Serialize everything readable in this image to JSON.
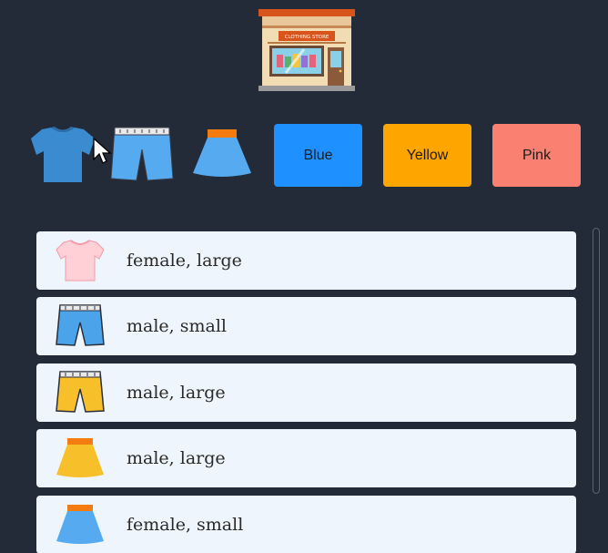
{
  "header": {
    "icon": "clothing-store-icon",
    "sign_text": "CLOTHING STORE"
  },
  "clothing_buttons": [
    {
      "icon": "tshirt-icon",
      "color": "#3b8bd0"
    },
    {
      "icon": "shorts-icon",
      "color": "#55aaf0"
    },
    {
      "icon": "skirt-icon",
      "color": "#55aaf0"
    }
  ],
  "color_buttons": [
    {
      "label": "Blue",
      "color": "#1e90ff"
    },
    {
      "label": "Yellow",
      "color": "#ffa500"
    },
    {
      "label": "Pink",
      "color": "#fa8072"
    }
  ],
  "items": [
    {
      "label": "female, large",
      "icon": "tshirt-icon",
      "color": "#ffd0d6"
    },
    {
      "label": "male, small",
      "icon": "shorts-icon",
      "color": "#4ba3ea"
    },
    {
      "label": "male, large",
      "icon": "shorts-icon",
      "color": "#f7bf2a"
    },
    {
      "label": "male, large",
      "icon": "skirt-icon",
      "color": "#f7bf2a"
    },
    {
      "label": "female, small",
      "icon": "skirt-icon",
      "color": "#55aaf0"
    }
  ]
}
